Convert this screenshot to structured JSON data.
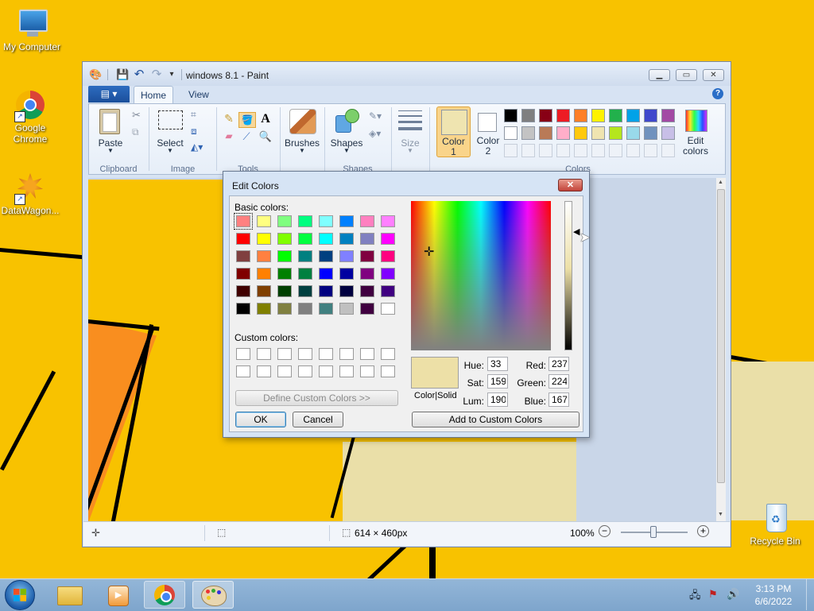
{
  "desktop": {
    "icons": [
      {
        "label": "My Computer"
      },
      {
        "label": "Google Chrome"
      },
      {
        "label": "DataWagon..."
      },
      {
        "label": "Recycle Bin"
      }
    ]
  },
  "paint": {
    "title": "windows 8.1 - Paint",
    "tabs": {
      "file": "▤ ▾",
      "home": "Home",
      "view": "View"
    },
    "ribbon": {
      "paste": "Paste",
      "select": "Select",
      "brushes": "Brushes",
      "shapes": "Shapes",
      "size": "Size",
      "color1": "Color\n1",
      "color1_a": "Color",
      "color1_b": "1",
      "color2_a": "Color",
      "color2_b": "2",
      "edit_colors_a": "Edit",
      "edit_colors_b": "colors",
      "groups": {
        "clipboard": "Clipboard",
        "image": "Image",
        "tools": "Tools",
        "shapes": "Shapes",
        "colors": "Colors"
      },
      "palette_row1": [
        "#000000",
        "#7f7f7f",
        "#880015",
        "#ed1c24",
        "#ff7f27",
        "#fff200",
        "#22b14c",
        "#00a2e8",
        "#3f48cc",
        "#a349a4"
      ],
      "palette_row2": [
        "#ffffff",
        "#c3c3c3",
        "#b97a57",
        "#ffaec9",
        "#ffc90e",
        "#efe4b0",
        "#b5e61d",
        "#99d9ea",
        "#7092be",
        "#c8bfe7"
      ],
      "color1_value": "#efe4b0",
      "color2_value": "#ffffff"
    },
    "status": {
      "canvas_size": "614 × 460px",
      "zoom": "100%"
    }
  },
  "edit_colors": {
    "title": "Edit Colors",
    "basic_label": "Basic colors:",
    "custom_label": "Custom colors:",
    "define_button": "Define Custom Colors >>",
    "ok_button": "OK",
    "cancel_button": "Cancel",
    "add_button": "Add to Custom Colors",
    "color_solid": "Color|Solid",
    "hue_label": "Hue:",
    "hue": "33",
    "sat_label": "Sat:",
    "sat": "159",
    "lum_label": "Lum:",
    "lum": "190",
    "red_label": "Red:",
    "red": "237",
    "green_label": "Green:",
    "green": "224",
    "blue_label": "Blue:",
    "blue": "167",
    "preview_color": "#ede0a7",
    "basic_colors": [
      [
        "#ff8080",
        "#ffff80",
        "#80ff80",
        "#00ff80",
        "#80ffff",
        "#0080ff",
        "#ff80c0",
        "#ff80ff"
      ],
      [
        "#ff0000",
        "#ffff00",
        "#80ff00",
        "#00ff40",
        "#00ffff",
        "#0080c0",
        "#8080c0",
        "#ff00ff"
      ],
      [
        "#804040",
        "#ff8040",
        "#00ff00",
        "#008080",
        "#004080",
        "#8080ff",
        "#800040",
        "#ff0080"
      ],
      [
        "#800000",
        "#ff8000",
        "#008000",
        "#008040",
        "#0000ff",
        "#0000a0",
        "#800080",
        "#8000ff"
      ],
      [
        "#400000",
        "#804000",
        "#004000",
        "#004040",
        "#000080",
        "#000040",
        "#400040",
        "#400080"
      ],
      [
        "#000000",
        "#808000",
        "#808040",
        "#808080",
        "#408080",
        "#c0c0c0",
        "#400040",
        "#ffffff"
      ]
    ]
  },
  "taskbar": {
    "time": "3:13 PM",
    "date": "6/6/2022"
  }
}
